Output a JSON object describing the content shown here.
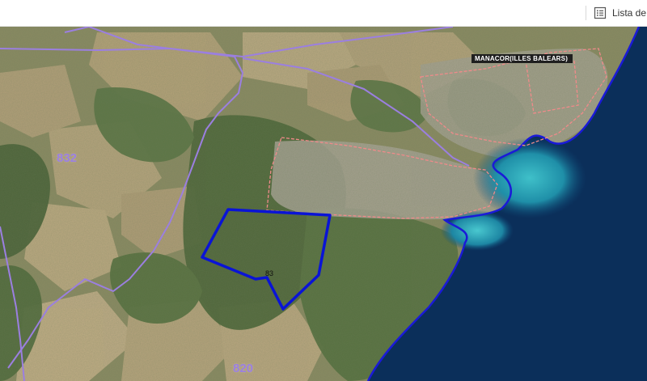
{
  "toolbar": {
    "list_label": "Lista de",
    "list_icon": "list-icon"
  },
  "map": {
    "municipality_label": "MANACOR(ILLES BALEARS)",
    "parcel_labels": [
      "832",
      "820"
    ],
    "selected_plot_label": "83",
    "colors": {
      "sea_deep": "#0b2f5a",
      "sea_shallow": "#2aa3b5",
      "coastline": "#1a1ad8",
      "selected_plot": "#0a14d6",
      "parcel_boundary": "#9b7fe0",
      "urban_boundary": "#f08a8a",
      "land_dry": "#b9a47c",
      "land_green": "#4f6a3c"
    }
  }
}
